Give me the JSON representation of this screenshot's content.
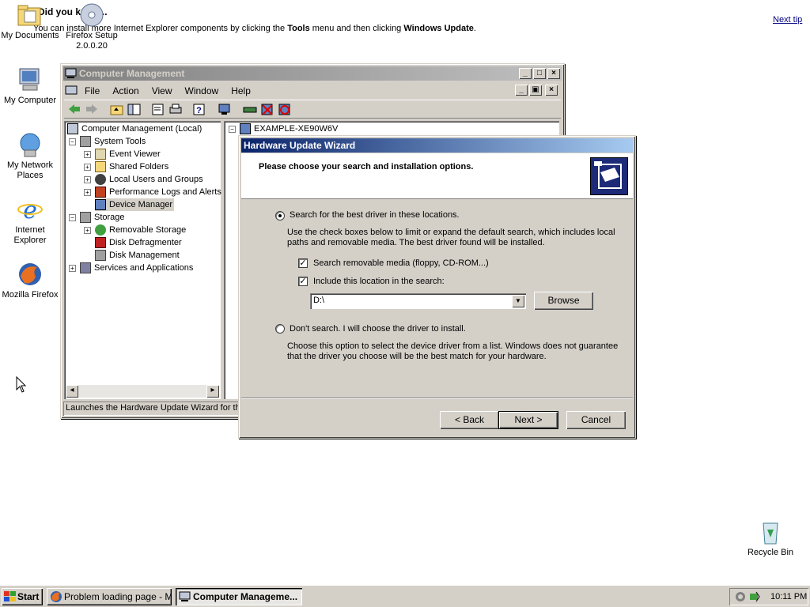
{
  "desktop": {
    "tip_title": "Did you know...",
    "tip_text_pre": "You can install more Internet Explorer components by clicking the ",
    "tip_text_bold1": "Tools",
    "tip_text_mid": " menu and then clicking ",
    "tip_text_bold2": "Windows Update",
    "tip_text_end": ".",
    "next_tip": "Next tip",
    "icons": {
      "my_documents": "My Documents",
      "firefox_setup": "Firefox Setup 2.0.0.20",
      "my_computer": "My Computer",
      "my_network": "My Network Places",
      "ie": "Internet Explorer",
      "firefox": "Mozilla Firefox",
      "recycle_bin": "Recycle Bin"
    }
  },
  "mmc": {
    "title": "Computer Management",
    "menus": [
      "File",
      "Action",
      "View",
      "Window",
      "Help"
    ],
    "tree": {
      "root": "Computer Management (Local)",
      "system_tools": "System Tools",
      "event_viewer": "Event Viewer",
      "shared_folders": "Shared Folders",
      "local_users": "Local Users and Groups",
      "perf_logs": "Performance Logs and Alerts",
      "device_manager": "Device Manager",
      "storage": "Storage",
      "removable_storage": "Removable Storage",
      "disk_defrag": "Disk Defragmenter",
      "disk_mgmt": "Disk Management",
      "services_apps": "Services and Applications"
    },
    "right_root": "EXAMPLE-XE90W6V",
    "status": "Launches the Hardware Update Wizard for the"
  },
  "wizard": {
    "title": "Hardware Update Wizard",
    "heading": "Please choose your search and installation options.",
    "opt_search": "Search for the best driver in these locations.",
    "opt_search_desc": "Use the check boxes below to limit or expand the default search, which includes local paths and removable media. The best driver found will be installed.",
    "chk_removable": "Search removable media (floppy, CD-ROM...)",
    "chk_location": "Include this location in the search:",
    "location_value": "D:\\",
    "browse": "Browse",
    "opt_dont": "Don't search. I will choose the driver to install.",
    "opt_dont_desc": "Choose this option to select the device driver from a list.  Windows does not guarantee that the driver you choose will be the best match for your hardware.",
    "back": "< Back",
    "next": "Next >",
    "cancel": "Cancel",
    "selected_option": "search",
    "chk_removable_checked": true,
    "chk_location_checked": true
  },
  "taskbar": {
    "start": "Start",
    "task1": "Problem loading page - M...",
    "task2": "Computer Manageme...",
    "clock": "10:11 PM"
  },
  "colors": {
    "active_title": "#0a246a",
    "inactive_title": "#808080",
    "face": "#d4d0c8"
  }
}
